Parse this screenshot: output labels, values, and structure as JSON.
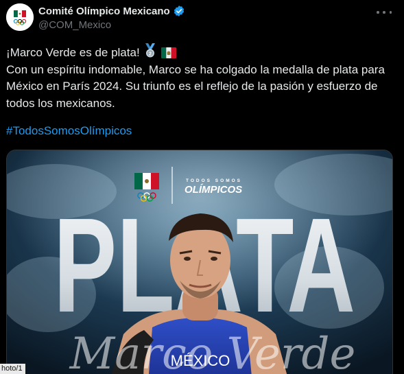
{
  "account": {
    "display_name": "Comité Olímpico Mexicano",
    "handle": "@COM_Mexico"
  },
  "tweet": {
    "line1": "¡Marco Verde es de plata!",
    "line2": "Con un espíritu indomable, Marco se ha colgado la medalla de plata para",
    "line3": "México en París 2024. Su triunfo es el reflejo de la pasión y esfuerzo de",
    "line4": "todos los mexicanos.",
    "hashtag": "#TodosSomosOlímpicos"
  },
  "media": {
    "campaign_top": "TODOS SOMOS",
    "campaign_main": "OLÍMPICOS",
    "big_word": "PLATA",
    "jersey_text": "MÉXICO",
    "script_text": "Marco Verde",
    "photo_label": "hoto/1"
  },
  "icons": {
    "verified": "verified-badge-icon",
    "more": "more-options-icon",
    "medal": "silver-medal-icon",
    "flag": "mexico-flag-icon"
  },
  "colors": {
    "link": "#1d9bf0",
    "verified": "#1d9bf0",
    "secondary_text": "#71767b",
    "flag_green": "#006847",
    "flag_red": "#ce1126"
  }
}
